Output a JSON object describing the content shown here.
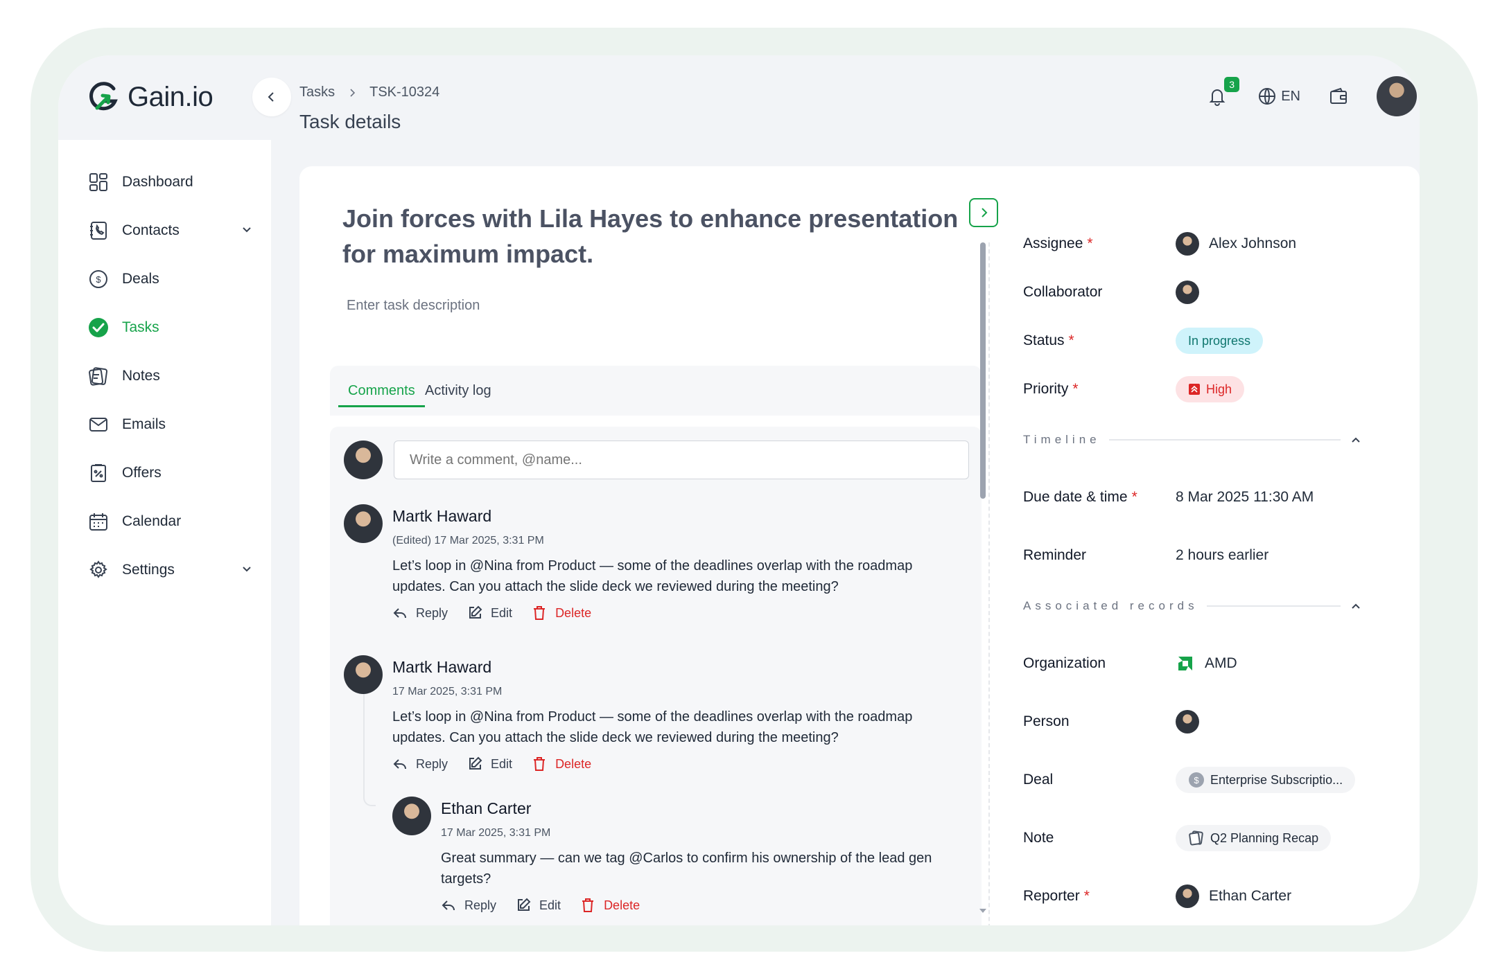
{
  "app": {
    "brand": "Gain.io"
  },
  "sidebar": {
    "items": [
      {
        "label": "Dashboard",
        "icon": "dashboard-icon"
      },
      {
        "label": "Contacts",
        "icon": "contacts-icon",
        "expandable": true
      },
      {
        "label": "Deals",
        "icon": "deals-icon"
      },
      {
        "label": "Tasks",
        "icon": "tasks-icon",
        "active": true
      },
      {
        "label": "Notes",
        "icon": "notes-icon"
      },
      {
        "label": "Emails",
        "icon": "emails-icon"
      },
      {
        "label": "Offers",
        "icon": "offers-icon"
      },
      {
        "label": "Calendar",
        "icon": "calendar-icon"
      },
      {
        "label": "Settings",
        "icon": "settings-icon",
        "expandable": true
      }
    ]
  },
  "header": {
    "breadcrumb": [
      "Tasks",
      "TSK-10324"
    ],
    "title": "Task details",
    "notification_count": "3",
    "language": "EN"
  },
  "task": {
    "title": "Join forces with Lila Hayes to enhance presentation for maximum impact.",
    "description_placeholder": "Enter task description"
  },
  "tabs": [
    "Comments",
    "Activity log"
  ],
  "comment_input": {
    "placeholder": "Write a comment, @name..."
  },
  "comments": [
    {
      "author": "Martk Haward",
      "date": "(Edited) 17 Mar 2025, 3:31 PM",
      "text": "Let’s loop in @Nina from Product — some of the deadlines overlap with the roadmap updates. Can you attach the slide deck we reviewed during the meeting?"
    },
    {
      "author": "Martk Haward",
      "date": "17 Mar 2025, 3:31 PM",
      "text": "Let’s loop in @Nina from Product — some of the deadlines overlap with the roadmap updates. Can you attach the slide deck we reviewed during the meeting?"
    },
    {
      "author": "Ethan Carter",
      "date": "17 Mar 2025, 3:31 PM",
      "text": "Great summary — can we tag @Carlos to confirm his ownership of the lead gen targets?"
    }
  ],
  "actions": {
    "reply": "Reply",
    "edit": "Edit",
    "delete": "Delete"
  },
  "details": {
    "assignee": {
      "label": "Assignee",
      "value": "Alex Johnson"
    },
    "collaborator": {
      "label": "Collaborator"
    },
    "status": {
      "label": "Status",
      "value": "In progress"
    },
    "priority": {
      "label": "Priority",
      "value": "High"
    },
    "timeline_header": "Timeline",
    "due": {
      "label": "Due date & time",
      "value": "8 Mar 2025 11:30 AM"
    },
    "reminder": {
      "label": "Reminder",
      "value": "2 hours earlier"
    },
    "associated_header": "Associated records",
    "organization": {
      "label": "Organization",
      "value": "AMD"
    },
    "person": {
      "label": "Person"
    },
    "deal": {
      "label": "Deal",
      "value": "Enterprise Subscriptio..."
    },
    "note": {
      "label": "Note",
      "value": "Q2 Planning Recap"
    },
    "reporter": {
      "label": "Reporter",
      "value": "Ethan Carter"
    }
  },
  "colors": {
    "accent": "#16a34a",
    "danger": "#dc2626",
    "status_bg": "#cff3fb",
    "priority_bg": "#fde2e4"
  }
}
